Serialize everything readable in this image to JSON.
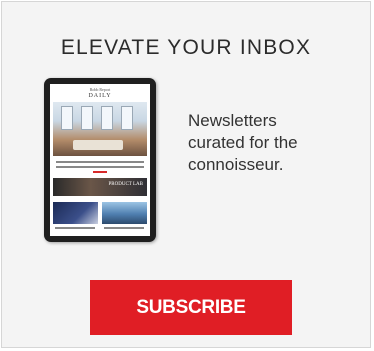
{
  "headline": "ELEVATE YOUR INBOX",
  "device": {
    "brand": "Robb Report",
    "title": "DAILY",
    "banner_text": "PRODUCT LAB"
  },
  "tagline": [
    "Newsletters",
    "curated for the",
    "connoisseur."
  ],
  "subscribe_label": "SUBSCRIBE",
  "colors": {
    "accent": "#e01e25",
    "panel_background": "#f4f4f4",
    "text": "#333333"
  }
}
